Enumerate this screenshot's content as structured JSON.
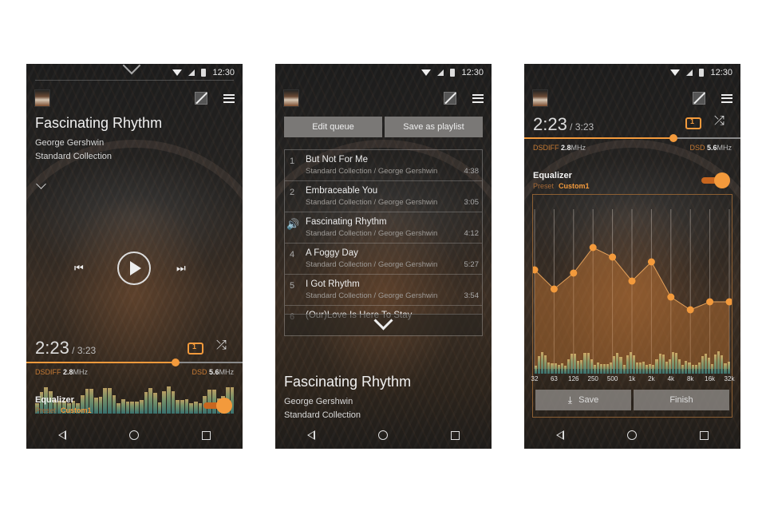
{
  "status": {
    "time": "12:30"
  },
  "screens": {
    "now_playing": {
      "track_title": "Fascinating Rhythm",
      "artist": "George Gershwin",
      "album": "Standard Collection",
      "time_current": "2:23",
      "time_total": " / 3:23",
      "progress_fraction": 0.69,
      "format_left": {
        "label": "DSDIFF ",
        "value": "2.8",
        "unit": "MHz"
      },
      "format_right": {
        "label": "DSD ",
        "value": "5.6",
        "unit": "MHz"
      },
      "equalizer_label": "Equalizer",
      "preset_label": "Preset",
      "preset_value": "Custom1",
      "equalizer_enabled": true,
      "prev_glyph": "⏮",
      "next_glyph": "⏭",
      "repeat_mode": "repeat-one",
      "shuffle_glyph": "⤮"
    },
    "queue": {
      "edit_queue_label": "Edit queue",
      "save_playlist_label": "Save as playlist",
      "items": [
        {
          "num": "1",
          "title": "But Not For Me",
          "subtitle": "Standard Collection / George Gershwin",
          "duration": "4:38",
          "playing": false
        },
        {
          "num": "2",
          "title": "Embraceable You",
          "subtitle": "Standard Collection / George Gershwin",
          "duration": "3:05",
          "playing": false
        },
        {
          "num": "",
          "title": "Fascinating Rhythm",
          "subtitle": "Standard Collection / George Gershwin",
          "duration": "4:12",
          "playing": true
        },
        {
          "num": "4",
          "title": "A Foggy Day",
          "subtitle": "Standard Collection / George Gershwin",
          "duration": "5:27",
          "playing": false
        },
        {
          "num": "5",
          "title": "I Got Rhythm",
          "subtitle": "Standard Collection / George Gershwin",
          "duration": "3:54",
          "playing": false
        },
        {
          "num": "6",
          "title": "(Our)Love Is Here To Stay",
          "subtitle": "",
          "duration": "",
          "playing": false
        }
      ],
      "speaker_glyph": "🔊",
      "track_title": "Fascinating Rhythm",
      "artist": "George Gershwin",
      "album": "Standard Collection"
    },
    "equalizer": {
      "time_current": "2:23",
      "time_total": " / 3:23",
      "progress_fraction": 0.69,
      "format_left": {
        "label": "DSDIFF ",
        "value": "2.8",
        "unit": "MHz"
      },
      "format_right": {
        "label": "DSD ",
        "value": "5.6",
        "unit": "MHz"
      },
      "equalizer_label": "Equalizer",
      "preset_label": "Preset",
      "preset_value": "Custom1",
      "bands": [
        "32",
        "63",
        "126",
        "250",
        "500",
        "1k",
        "2k",
        "4k",
        "8k",
        "16k",
        "32k"
      ],
      "band_levels": [
        0.62,
        0.5,
        0.6,
        0.76,
        0.7,
        0.55,
        0.67,
        0.45,
        0.37,
        0.42,
        0.42
      ],
      "save_label": "Save",
      "finish_label": "Finish"
    }
  },
  "colors": {
    "accent": "#f39a3c",
    "accent_dark": "#c8661f",
    "format_label": "#c57a34"
  }
}
